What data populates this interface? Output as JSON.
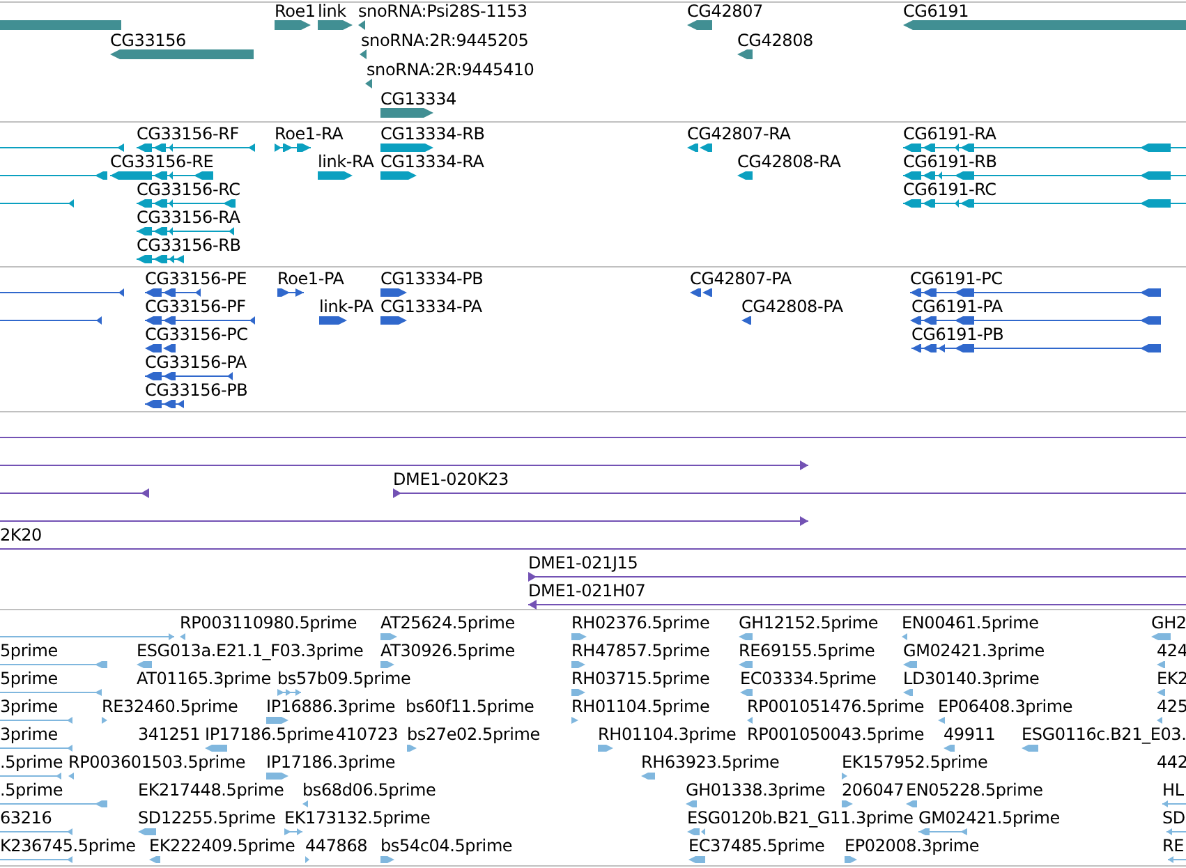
{
  "tracks": [
    {
      "kind": "gene",
      "features": [
        {
          "kind": "plain"
        },
        {
          "label": "CG33156",
          "kind": "reverse"
        },
        {
          "label": "Roe1",
          "kind": "forward"
        },
        {
          "label": "link",
          "kind": "forward"
        },
        {
          "label": "snoRNA:Psi28S-1153",
          "kind": "reverse"
        },
        {
          "label": "snoRNA:2R:9445205",
          "kind": "reverse"
        },
        {
          "label": "snoRNA:2R:9445410",
          "kind": "reverse"
        },
        {
          "label": "CG13334",
          "kind": "forward"
        },
        {
          "label": "CG42807",
          "kind": "reverse"
        },
        {
          "label": "CG42808",
          "kind": "reverse"
        },
        {
          "label": "CG6191",
          "kind": "reverse"
        }
      ]
    },
    {
      "kind": "transcript",
      "features": [
        {
          "kind": "reverse"
        },
        {
          "label": "CG33156-RF",
          "kind": "reverse"
        },
        {
          "kind": "reverse"
        },
        {
          "label": "CG33156-RE",
          "kind": "reverse"
        },
        {
          "kind": "reverse"
        },
        {
          "label": "CG33156-RC",
          "kind": "reverse"
        },
        {
          "label": "CG33156-RA",
          "kind": "reverse"
        },
        {
          "label": "CG33156-RB",
          "kind": "reverse"
        },
        {
          "label": "Roe1-RA",
          "kind": "forward"
        },
        {
          "label": "link-RA",
          "kind": "forward"
        },
        {
          "label": "CG13334-RB",
          "kind": "forward"
        },
        {
          "label": "CG13334-RA",
          "kind": "forward"
        },
        {
          "label": "CG42807-RA",
          "kind": "reverse"
        },
        {
          "label": "CG42808-RA",
          "kind": "reverse"
        },
        {
          "label": "CG6191-RA",
          "kind": "reverse"
        },
        {
          "label": "CG6191-RB",
          "kind": "reverse"
        },
        {
          "label": "CG6191-RC",
          "kind": "reverse"
        }
      ]
    },
    {
      "kind": "protein",
      "features": [
        {
          "kind": "reverse"
        },
        {
          "label": "CG33156-PE",
          "kind": "reverse"
        },
        {
          "kind": "reverse"
        },
        {
          "label": "CG33156-PF",
          "kind": "reverse"
        },
        {
          "label": "CG33156-PC",
          "kind": "reverse"
        },
        {
          "label": "CG33156-PA",
          "kind": "reverse"
        },
        {
          "label": "CG33156-PB",
          "kind": "reverse"
        },
        {
          "label": "Roe1-PA",
          "kind": "forward"
        },
        {
          "label": "link-PA",
          "kind": "forward"
        },
        {
          "label": "CG13334-PB",
          "kind": "forward"
        },
        {
          "label": "CG13334-PA",
          "kind": "forward"
        },
        {
          "label": "CG42807-PA",
          "kind": "reverse"
        },
        {
          "label": "CG42808-PA",
          "kind": "reverse"
        },
        {
          "label": "CG6191-PC",
          "kind": "reverse"
        },
        {
          "label": "CG6191-PA",
          "kind": "reverse"
        },
        {
          "label": "CG6191-PB",
          "kind": "reverse"
        }
      ]
    },
    {
      "kind": "clone",
      "features": [
        {
          "kind": "plain"
        },
        {
          "kind": "forward"
        },
        {
          "kind": "reverse"
        },
        {
          "label": "DME1-020K23",
          "kind": "forward"
        },
        {
          "kind": "forward"
        },
        {
          "label": "2K20",
          "kind": "plain"
        },
        {
          "label": "DME1-021J15",
          "kind": "forward"
        },
        {
          "label": "DME1-021H07",
          "kind": "reverse"
        }
      ]
    },
    {
      "kind": "est",
      "features": [
        {
          "kind": "forward"
        },
        {
          "label": "RP003110980.5prime",
          "kind": "reverse"
        },
        {
          "label": "AT25624.5prime",
          "kind": "forward"
        },
        {
          "label": "RH02376.5prime",
          "kind": "forward"
        },
        {
          "label": "GH12152.5prime",
          "kind": "reverse"
        },
        {
          "label": "EN00461.5prime",
          "kind": "reverse"
        },
        {
          "label": "GH2",
          "kind": "reverse"
        },
        {
          "label": "5prime",
          "kind": "reverse"
        },
        {
          "label": "ESG013a.E21.1_F03.3prime",
          "kind": "reverse"
        },
        {
          "label": "AT30926.5prime",
          "kind": "forward"
        },
        {
          "label": "RH47857.5prime",
          "kind": "forward"
        },
        {
          "label": "RE69155.5prime",
          "kind": "reverse"
        },
        {
          "label": "GM02421.3prime",
          "kind": "reverse"
        },
        {
          "label": "424",
          "kind": "reverse"
        },
        {
          "label": "5prime",
          "kind": "reverse"
        },
        {
          "label": "AT01165.3prime",
          "kind": "text"
        },
        {
          "label": "bs57b09.5prime",
          "kind": "forward"
        },
        {
          "label": "RH03715.5prime",
          "kind": "forward"
        },
        {
          "label": "EC03334.5prime",
          "kind": "reverse"
        },
        {
          "label": "LD30140.3prime",
          "kind": "reverse"
        },
        {
          "label": "EK2",
          "kind": "reverse"
        },
        {
          "label": "3prime",
          "kind": "reverse"
        },
        {
          "label": "RE32460.5prime",
          "kind": "forward"
        },
        {
          "label": "IP16886.3prime",
          "kind": "forward"
        },
        {
          "label": "bs60f11.5prime",
          "kind": "text"
        },
        {
          "label": "RH01104.5prime",
          "kind": "forward"
        },
        {
          "label": "RP001051476.5prime",
          "kind": "reverse"
        },
        {
          "label": "EP06408.3prime",
          "kind": "reverse"
        },
        {
          "label": "425",
          "kind": "reverse"
        },
        {
          "label": "3prime",
          "kind": "reverse"
        },
        {
          "label": "341251",
          "kind": "text"
        },
        {
          "label": "IP17186.5prime",
          "kind": "reverse"
        },
        {
          "label": "410723",
          "kind": "text"
        },
        {
          "label": "bs27e02.5prime",
          "kind": "forward"
        },
        {
          "label": "RH01104.3prime",
          "kind": "forward"
        },
        {
          "label": "RP001050043.5prime",
          "kind": "text"
        },
        {
          "label": "49911",
          "kind": "reverse"
        },
        {
          "label": "ESG0116c.B21_E03.",
          "kind": "reverse"
        },
        {
          "label": ".5prime",
          "kind": "reverse"
        },
        {
          "label": "RP003601503.5prime",
          "kind": "reverse"
        },
        {
          "label": "IP17186.3prime",
          "kind": "forward"
        },
        {
          "label": "RH63923.5prime",
          "kind": "reverse"
        },
        {
          "label": "EK157952.5prime",
          "kind": "forward"
        },
        {
          "label": "442",
          "kind": "text"
        },
        {
          "label": ".5prime",
          "kind": "reverse"
        },
        {
          "label": "EK217448.5prime",
          "kind": "text"
        },
        {
          "label": "bs68d06.5prime",
          "kind": "reverse"
        },
        {
          "label": "GH01338.3prime",
          "kind": "reverse"
        },
        {
          "label": "206047",
          "kind": "forward"
        },
        {
          "label": "EN05228.5prime",
          "kind": "reverse"
        },
        {
          "label": "HL",
          "kind": "reverse"
        },
        {
          "label": "63216",
          "kind": "reverse"
        },
        {
          "label": "SD12255.5prime",
          "kind": "reverse"
        },
        {
          "label": "EK173132.5prime",
          "kind": "forward"
        },
        {
          "label": "ESG0120b.B21_G11.3prime",
          "kind": "reverse"
        },
        {
          "label": "GM02421.5prime",
          "kind": "reverse"
        },
        {
          "label": "SD",
          "kind": "reverse"
        },
        {
          "label": "K236745.5prime",
          "kind": "reverse"
        },
        {
          "label": "EK222409.5prime",
          "kind": "reverse"
        },
        {
          "label": "447868",
          "kind": "forward"
        },
        {
          "label": "bs54c04.5prime",
          "kind": "forward"
        },
        {
          "label": "EC37485.5prime",
          "kind": "reverse"
        },
        {
          "label": "EP02008.3prime",
          "kind": "forward"
        },
        {
          "label": "RE",
          "kind": "reverse"
        }
      ]
    }
  ]
}
